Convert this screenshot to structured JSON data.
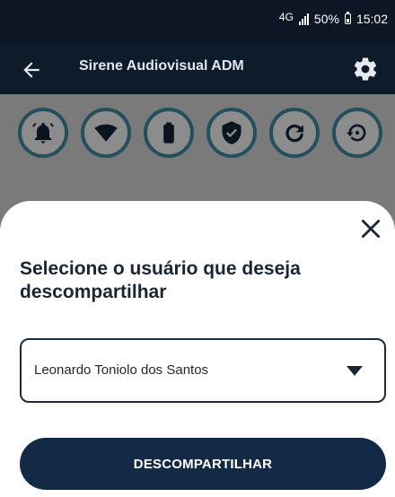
{
  "status_bar": {
    "network": "4G",
    "battery": "50%",
    "time": "15:02"
  },
  "app_bar": {
    "title": "Sirene Audiovisual ADM",
    "icons": [
      "arrow-left-icon",
      "gear-icon"
    ]
  },
  "toolbar_icons": [
    "bell-icon",
    "wifi-icon",
    "battery-icon",
    "shield-check-icon",
    "refresh-icon",
    "restore-icon"
  ],
  "sheet": {
    "title": "Selecione o usuário que deseja descompartilhar",
    "selected_user": "Leonardo Toniolo dos Santos",
    "action_label": "DESCOMPARTILHAR",
    "close_icon": "close-icon"
  },
  "colors": {
    "app_bar": "#0e1b2b",
    "button_primary": "#132a47",
    "icon_ring": "#244f5c",
    "overlay": "#7a7a7a"
  }
}
